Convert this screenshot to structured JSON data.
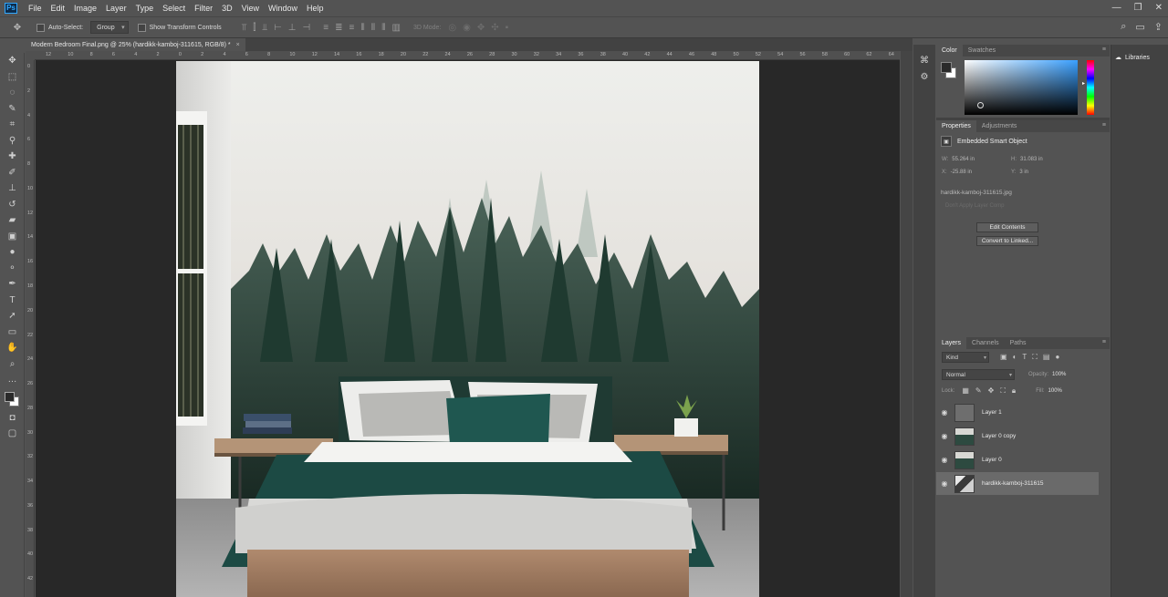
{
  "app": {
    "logo_text": "Ps",
    "menu": [
      "File",
      "Edit",
      "Image",
      "Layer",
      "Type",
      "Select",
      "Filter",
      "3D",
      "View",
      "Window",
      "Help"
    ],
    "window_controls": [
      "—",
      "❐",
      "✕"
    ]
  },
  "options_bar": {
    "auto_select_label": "Auto-Select:",
    "auto_select_target": "Group",
    "transform_controls_label": "Show Transform Controls",
    "mode_3d_label": "3D Mode:"
  },
  "document": {
    "tab_title": "Modern Bedroom Final.png @ 25% (hardikk-kamboj-311615, RGB/8) *",
    "tab_close": "×",
    "ruler_h_marks": [
      "12",
      "10",
      "8",
      "6",
      "4",
      "2",
      "0",
      "2",
      "4",
      "6",
      "8",
      "10",
      "12",
      "14",
      "16",
      "18",
      "20",
      "22",
      "24",
      "26",
      "28",
      "30",
      "32",
      "34",
      "36",
      "38",
      "40",
      "42",
      "44",
      "46",
      "48",
      "50",
      "52",
      "54",
      "56",
      "58",
      "60",
      "62",
      "64"
    ],
    "ruler_v_marks": [
      "0",
      "2",
      "4",
      "6",
      "8",
      "10",
      "12",
      "14",
      "16",
      "18",
      "20",
      "22",
      "24",
      "26",
      "28",
      "30",
      "32",
      "34",
      "36",
      "38",
      "40",
      "42"
    ]
  },
  "panels": {
    "color": {
      "tabs": [
        "Color",
        "Swatches"
      ],
      "foreground": "#2a2a2a",
      "background": "#ffffff"
    },
    "properties": {
      "tabs": [
        "Properties",
        "Adjustments"
      ],
      "title": "Embedded Smart Object",
      "w_label": "W:",
      "w_value": "55.264 in",
      "h_label": "H:",
      "h_value": "31.083 in",
      "x_label": "X:",
      "x_value": "-25.88 in",
      "y_label": "Y:",
      "y_value": "3 in",
      "filename": "hardikk-kamboj-311615.jpg",
      "layer_comp_placeholder": "Don't Apply Layer Comp",
      "edit_contents": "Edit Contents",
      "convert_linked": "Convert to Linked..."
    },
    "layers": {
      "tabs": [
        "Layers",
        "Channels",
        "Paths"
      ],
      "filter_kind": "Kind",
      "blend_mode": "Normal",
      "opacity_label": "Opacity:",
      "opacity_value": "100%",
      "lock_label": "Lock:",
      "fill_label": "Fill:",
      "fill_value": "100%",
      "items": [
        {
          "name": "Layer 1",
          "selected": false
        },
        {
          "name": "Layer 0 copy",
          "selected": false
        },
        {
          "name": "Layer 0",
          "selected": false
        },
        {
          "name": "hardikk-kamboj-311615",
          "selected": true
        }
      ]
    },
    "libraries": {
      "label": "Libraries"
    }
  },
  "colors": {
    "ui_dark": "#535353",
    "ui_darker": "#424242",
    "canvas_bg": "#282828",
    "accent": "#31a8ff"
  }
}
